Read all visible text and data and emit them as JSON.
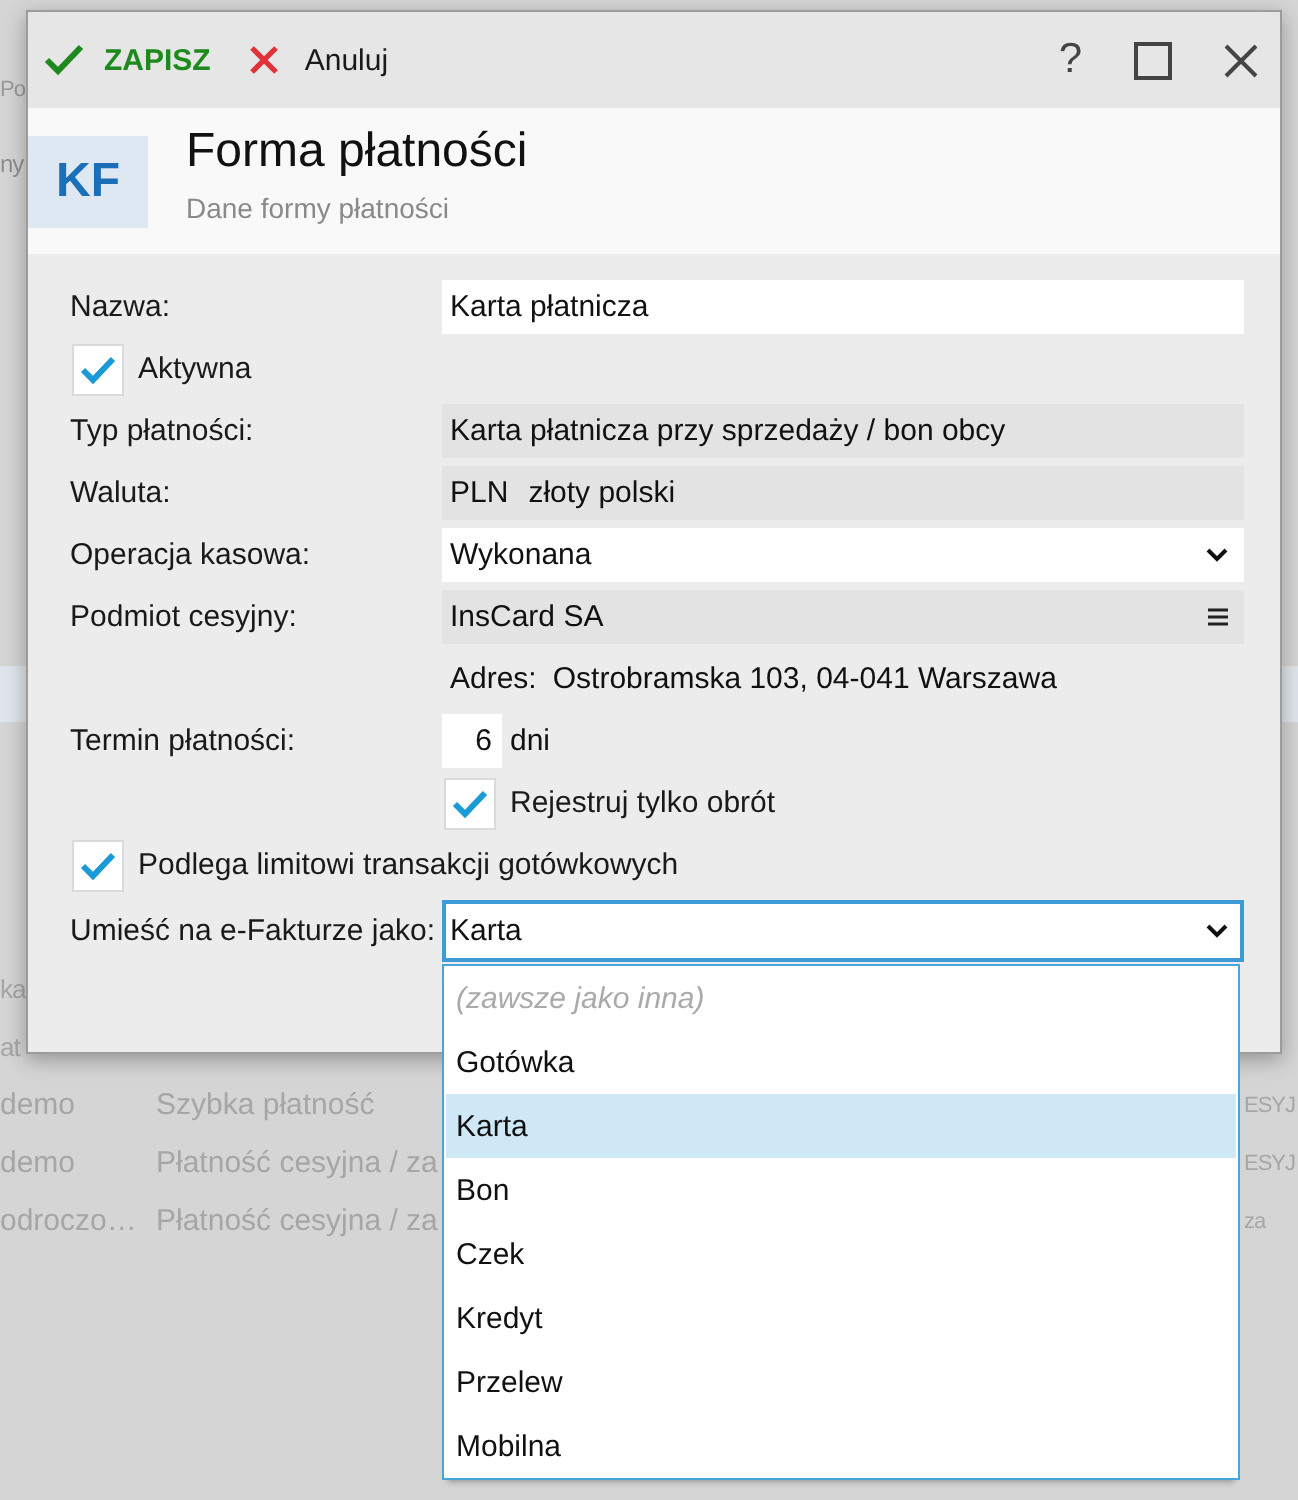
{
  "background": {
    "fragments": [
      "Po",
      "ny"
    ],
    "rows": [
      {
        "column_1": "ka"
      },
      {
        "column_1": "at"
      },
      {
        "column_1": "demo",
        "column_2": "Szybka płatność",
        "column_3": "ESYJ"
      },
      {
        "column_1": "demo",
        "column_2": "Płatność cesyjna / za",
        "column_3": "ESYJ"
      },
      {
        "column_1": "odroczo…",
        "column_2": "Płatność cesyjna / za",
        "column_3": "za"
      }
    ]
  },
  "dialog": {
    "toolbar": {
      "save": "ZAPISZ",
      "cancel": "Anuluj",
      "help": "?"
    },
    "header": {
      "badge": "KF",
      "title": "Forma płatności",
      "subtitle": "Dane formy płatności"
    },
    "fields": [
      {
        "kind": "text",
        "label": "Nazwa:",
        "value": "Karta płatnicza"
      },
      {
        "kind": "checkbox",
        "text": "Aktywna",
        "checked": true
      },
      {
        "kind": "readonly",
        "label": "Typ płatności:",
        "value": "Karta płatnicza przy sprzedaży / bon obcy"
      },
      {
        "kind": "currency",
        "label": "Waluta:",
        "code": "PLN",
        "value": "złoty polski"
      },
      {
        "kind": "select",
        "label": "Operacja kasowa:",
        "value": "Wykonana",
        "open": false
      },
      {
        "kind": "lookup",
        "label": "Podmiot cesyjny:",
        "value": "InsCard SA"
      },
      {
        "kind": "address",
        "label": "Adres:",
        "value": "Ostrobramska 103, 04-041 Warszawa"
      },
      {
        "kind": "days",
        "label": "Termin płatności:",
        "value": "6",
        "unit": "dni"
      },
      {
        "kind": "sub_checkbox",
        "text": "Rejestruj tylko obrót",
        "checked": true
      },
      {
        "kind": "checkbox",
        "text": "Podlega limitowi transakcji gotówkowych",
        "checked": true
      },
      {
        "kind": "select",
        "label": "Umieść na e-Fakturze jako:",
        "value": "Karta",
        "open": true,
        "options": [
          {
            "label": "(zawsze jako inna)",
            "kind": "placeholder",
            "selected": false
          },
          {
            "label": "Gotówka",
            "kind": "option",
            "selected": false
          },
          {
            "label": "Karta",
            "kind": "option",
            "selected": true
          },
          {
            "label": "Bon",
            "kind": "option",
            "selected": false
          },
          {
            "label": "Czek",
            "kind": "option",
            "selected": false
          },
          {
            "label": "Kredyt",
            "kind": "option",
            "selected": false
          },
          {
            "label": "Przelew",
            "kind": "option",
            "selected": false
          },
          {
            "label": "Mobilna",
            "kind": "option",
            "selected": false
          }
        ]
      }
    ]
  }
}
